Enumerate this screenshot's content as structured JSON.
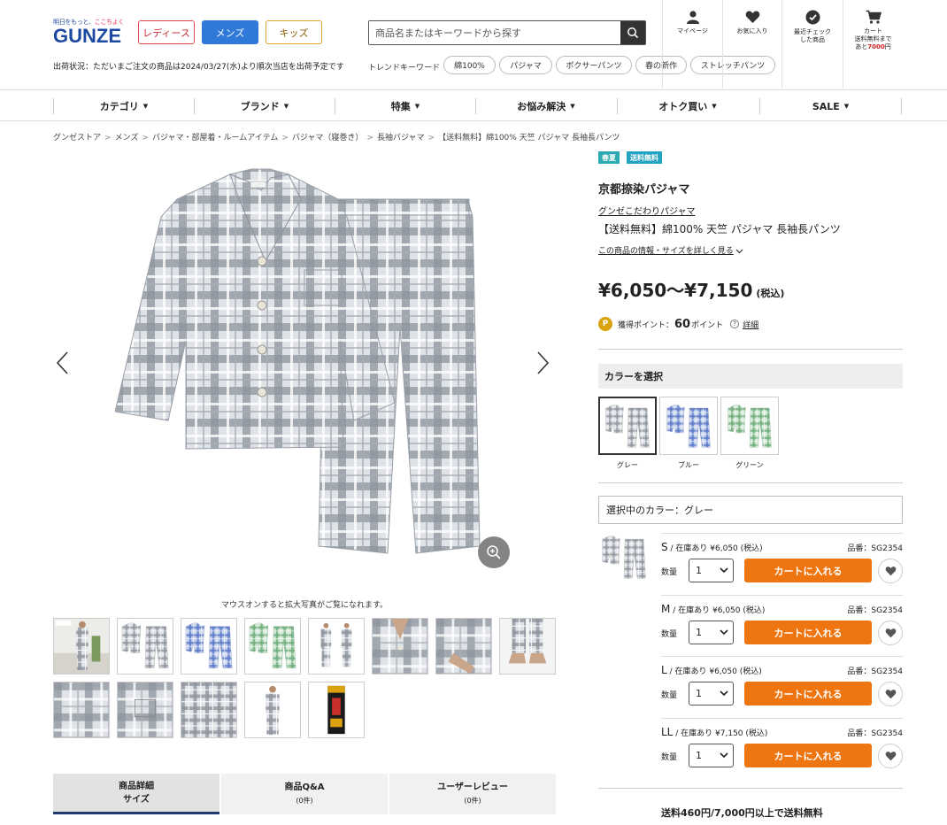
{
  "header": {
    "logo_tagline_pre": "明日をもっと、",
    "logo_tagline_mid": "ここちよく",
    "logo_word": "GUNZE",
    "gender_tabs": {
      "ladies": "レディース",
      "mens": "メンズ",
      "kids": "キッズ"
    },
    "shipping_status": "出荷状況：ただいまご注文の商品は2024/03/27(水)より順次当店を出荷予定です",
    "search_placeholder": "商品名またはキーワードから探す",
    "trend_label": "トレンドキーワード",
    "trend_chips": [
      "綿100%",
      "パジャマ",
      "ボクサーパンツ",
      "春の新作",
      "ストレッチパンツ"
    ],
    "icons": {
      "mypage": "マイページ",
      "favorites": "お気に入り",
      "recent": "最近チェック\nした商品",
      "cart": "カート",
      "cart_sub1": "送料無料まで",
      "cart_sub2_pre": "あと",
      "cart_sub2_amount": "7000",
      "cart_sub2_post": "円"
    }
  },
  "nav": [
    "カテゴリ",
    "ブランド",
    "特集",
    "お悩み解決",
    "オトク買い",
    "SALE"
  ],
  "breadcrumb": [
    "グンゼストア",
    "メンズ",
    "パジャマ・部屋着・ルームアイテム",
    "パジャマ（寝巻き）",
    "長袖パジャマ",
    "【送料無料】綿100% 天竺 パジャマ 長袖長パンツ"
  ],
  "gallery": {
    "hover_note": "マウスオンすると拡大写真がご覧になれます。"
  },
  "tabs": [
    {
      "label": "商品詳細",
      "sub": "サイズ"
    },
    {
      "label": "商品Q&A",
      "sub": "(0件)"
    },
    {
      "label": "ユーザーレビュー",
      "sub": "(0件)"
    }
  ],
  "product": {
    "badges": [
      "春夏",
      "送料無料"
    ],
    "name": "京都捺染パジャマ",
    "brand_link": "グンゼこだわりパジャマ",
    "full_name": "【送料無料】綿100% 天竺 パジャマ 長袖長パンツ",
    "detail_link": "この商品の情報・サイズを詳しく見る",
    "price": "¥6,050〜¥7,150",
    "tax_label": "(税込)",
    "points_label": "獲得ポイント：",
    "points_value": "60",
    "points_unit": "ポイント",
    "points_detail": "詳細"
  },
  "colors": {
    "heading": "カラーを選択",
    "options": [
      "グレー",
      "ブルー",
      "グリーン"
    ],
    "selected_label": "選択中のカラー：グレー"
  },
  "skus": [
    {
      "size": "S",
      "stock": "在庫あり",
      "price": "¥6,050",
      "tax": "(税込)",
      "code": "品番：SG2354",
      "qty_label": "数量",
      "qty": "1",
      "cart": "カートに入れる"
    },
    {
      "size": "M",
      "stock": "在庫あり",
      "price": "¥6,050",
      "tax": "(税込)",
      "code": "品番：SG2354",
      "qty_label": "数量",
      "qty": "1",
      "cart": "カートに入れる"
    },
    {
      "size": "L",
      "stock": "在庫あり",
      "price": "¥6,050",
      "tax": "(税込)",
      "code": "品番：SG2354",
      "qty_label": "数量",
      "qty": "1",
      "cart": "カートに入れる"
    },
    {
      "size": "LL",
      "stock": "在庫あり",
      "price": "¥7,150",
      "tax": "(税込)",
      "code": "品番：SG2354",
      "qty_label": "数量",
      "qty": "1",
      "cart": "カートに入れる"
    }
  ],
  "shipping_note": "送料460円/7,000円以上で送料無料",
  "colors_hex": {
    "mens_blue": "#2f7ad9",
    "cart_orange": "#ee7510",
    "badge_green": "#2aa9b0",
    "badge_teal": "#22a2c0",
    "brand_navy": "#1d4aa0",
    "alert_red": "#d1232a"
  }
}
